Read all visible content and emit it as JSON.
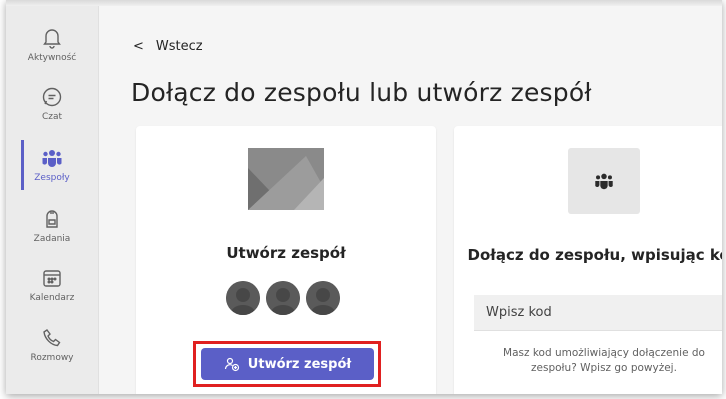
{
  "rail": {
    "items": [
      {
        "label": "Aktywność",
        "icon": "bell-icon"
      },
      {
        "label": "Czat",
        "icon": "chat-icon"
      },
      {
        "label": "Zespoły",
        "icon": "teams-icon",
        "active": true
      },
      {
        "label": "Zadania",
        "icon": "assignments-icon"
      },
      {
        "label": "Kalendarz",
        "icon": "calendar-icon"
      },
      {
        "label": "Rozmowy",
        "icon": "phone-icon"
      }
    ]
  },
  "header": {
    "back_label": "Wstecz",
    "title": "Dołącz do zespołu lub utwórz zespół"
  },
  "create_card": {
    "title": "Utwórz zespół",
    "button_label": "Utwórz zespół"
  },
  "join_card": {
    "title": "Dołącz do zespołu, wpisując kod",
    "input_placeholder": "Wpisz kod",
    "hint": "Masz kod umożliwiający dołączenie do zespołu? Wpisz go powyżej."
  },
  "colors": {
    "accent": "#5b5fc7",
    "highlight": "#e02020"
  }
}
